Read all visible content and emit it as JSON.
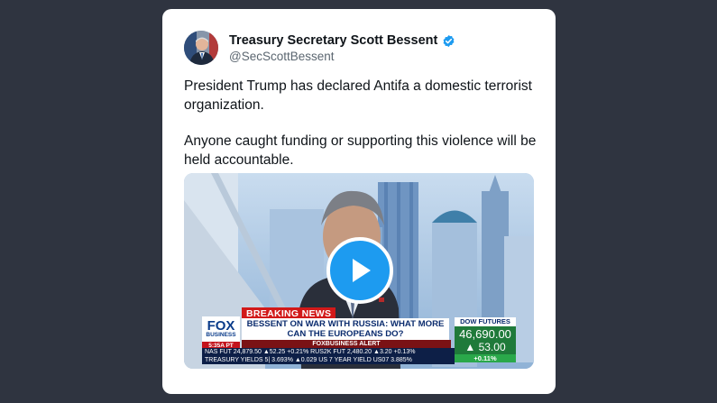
{
  "tweet": {
    "author_name": "Treasury Secretary Scott Bessent",
    "handle": "@SecScottBessent",
    "paragraphs": [
      "President Trump has declared Antifa a domestic terrorist organization.",
      "Anyone caught funding or supporting this violence will be held accountable."
    ]
  },
  "video": {
    "breaking": "BREAKING NEWS",
    "network_name": "FOX",
    "network_sub": "BUSINESS",
    "time": "5:35A PT",
    "headline": "BESSENT ON WAR WITH RUSSIA: WHAT MORE CAN THE EUROPEANS DO?",
    "alert": "FOXBUSINESS ALERT",
    "dow_label": "DOW FUTURES",
    "dow_value": "46,690.00",
    "dow_change": "▲ 53.00",
    "dow_pct": "+0.11%",
    "ticker_line1": "NAS FUT  24,879.50 ▲52.25 +0.21%  RUS2K FUT  2,480.20 ▲3.20 +0.13%",
    "ticker_line2": "TREASURY YIELDS 5|  3.693% ▲0.029   US 7 YEAR YIELD US07  3.885%"
  },
  "colors": {
    "page_background": "#2f3440",
    "verified_badge": "#1d9bf0",
    "play_button": "#1d9bf0"
  }
}
